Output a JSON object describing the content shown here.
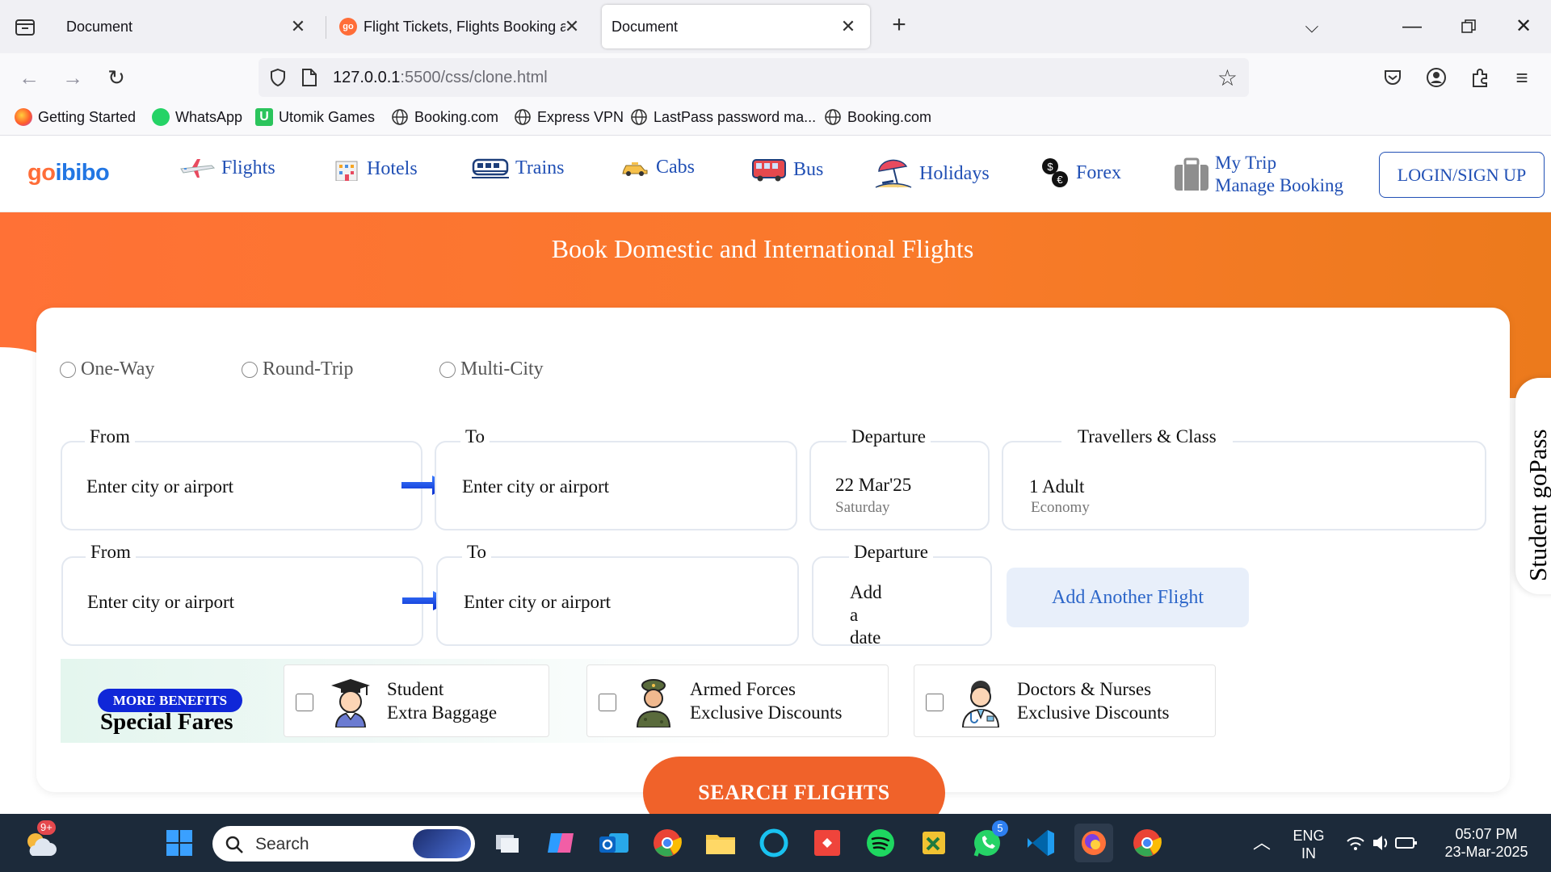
{
  "browser": {
    "tabs": [
      {
        "title": "Document",
        "active": false
      },
      {
        "title": "Flight Tickets, Flights Booking at",
        "active": false
      },
      {
        "title": "Document",
        "active": true
      }
    ],
    "url_host": "127.0.0.1",
    "url_rest": ":5500/css/clone.html",
    "bookmarks": [
      "Getting Started",
      "WhatsApp",
      "Utomik Games",
      "Booking.com",
      "Express VPN",
      "LastPass password ma...",
      "Booking.com"
    ]
  },
  "site": {
    "logo_go": "go",
    "logo_rest": "ibibo",
    "nav": [
      "Flights",
      "Hotels",
      "Trains",
      "Cabs",
      "Bus",
      "Holidays",
      "Forex"
    ],
    "mytrip_line1": "My Trip",
    "mytrip_line2": "Manage Booking",
    "login_label": "LOGIN/SIGN UP",
    "hero_title": "Book Domestic and International Flights"
  },
  "search": {
    "trip_types": [
      "One-Way",
      "Round-Trip",
      "Multi-City"
    ],
    "row1": {
      "from_label": "From",
      "from_value": "Enter city or airport",
      "to_label": "To",
      "to_value": "Enter city or airport",
      "departure_label": "Departure",
      "departure_value": "22 Mar'25",
      "departure_day": "Saturday",
      "travellers_label": "Travellers & Class",
      "travellers_value": "1 Adult",
      "class_value": "Economy"
    },
    "row2": {
      "from_label": "From",
      "from_value": "Enter city or airport",
      "to_label": "To",
      "to_value": "Enter city or airport",
      "departure_label": "Departure",
      "departure_line1": "Add",
      "departure_line2": "a",
      "departure_line3": "date"
    },
    "add_flight_label": "Add Another Flight",
    "more_benefits": "MORE BENEFITS",
    "special_fares": "Special Fares",
    "benefits": [
      {
        "line1": "Student",
        "line2": "Extra Baggage"
      },
      {
        "line1": "Armed Forces",
        "line2": "Exclusive Discounts"
      },
      {
        "line1": "Doctors & Nurses",
        "line2": "Exclusive Discounts"
      }
    ],
    "search_label": "SEARCH FLIGHTS",
    "gopass_label": "Student goPass"
  },
  "taskbar": {
    "search_label": "Search",
    "notif_badge": "9+",
    "whatsapp_badge": "5",
    "lang1": "ENG",
    "lang2": "IN",
    "time": "05:07 PM",
    "date": "23-Mar-2025"
  },
  "colors": {
    "accent_orange": "#f0622a",
    "nav_blue": "#2150b5",
    "logo_blue": "#2276e3"
  }
}
